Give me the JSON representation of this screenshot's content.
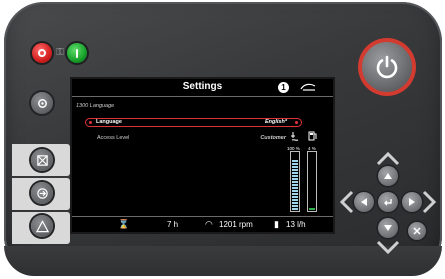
{
  "screen": {
    "title": "Settings",
    "step_badge": "1",
    "path": "1300 Language",
    "selected_row": {
      "label": "Language",
      "value": "English*"
    },
    "row2": {
      "label": "Access Level",
      "value": "Customer"
    },
    "gauge_left_label": "100 %",
    "gauge_right_label": "4 %",
    "temp_gauge_fraction": 0.9,
    "fuel_gauge_fraction": 0.04,
    "status": {
      "hours": "7 h",
      "rpm": "1201 rpm",
      "fuel_rate": "13 l/h"
    }
  },
  "colors": {
    "highlight": "#e3313c",
    "power_ring": "#d33b30",
    "start_green": "#17a02a",
    "stop_red": "#d31f1f"
  },
  "icons": [
    "stop-button-icon",
    "start-button-icon",
    "key-lock-icon",
    "settings-gear-icon",
    "alarm-list-icon",
    "exit-arrow-icon",
    "warning-triangle-icon",
    "power-icon",
    "arrow-up-icon",
    "arrow-down-icon",
    "arrow-left-icon",
    "arrow-right-icon",
    "enter-icon",
    "close-icon"
  ]
}
